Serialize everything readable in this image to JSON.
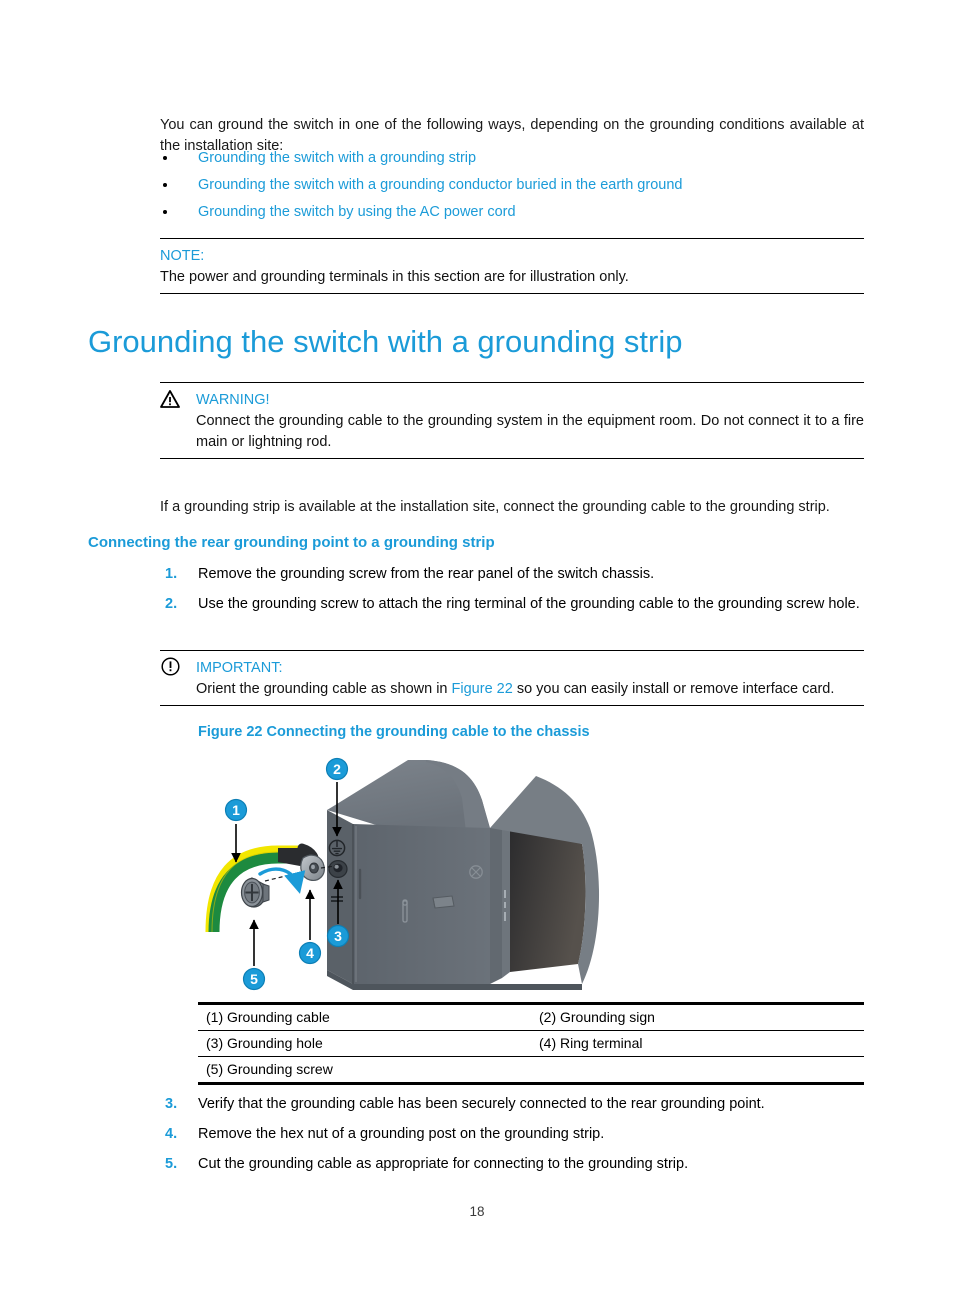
{
  "intro": {
    "paragraph": "You can ground the switch in one of the following ways, depending on the grounding conditions available at the installation site:"
  },
  "bullets": [
    {
      "label": "Grounding the switch with a grounding strip"
    },
    {
      "label": "Grounding the switch with a grounding conductor buried in the earth ground"
    },
    {
      "label": "Grounding the switch by using the AC power cord"
    }
  ],
  "note": {
    "title": "NOTE:",
    "body": "The power and grounding terminals in this section are for illustration only."
  },
  "heading": {
    "h1": "Grounding the switch with a grounding strip",
    "h3": "Connecting the rear grounding point to a grounding strip"
  },
  "warning": {
    "icon": "warning-triangle-icon",
    "title": "WARNING!",
    "body": "Connect the grounding cable to the grounding system in the equipment room. Do not connect it to a fire main or lightning rod."
  },
  "paragraph_after_warning": "If a grounding strip is available at the installation site, connect the grounding cable to the grounding strip.",
  "steps_first": [
    {
      "num": "1.",
      "text": "Remove the grounding screw from the rear panel of the switch chassis."
    },
    {
      "num": "2.",
      "text": "Use the grounding screw to attach the ring terminal of the grounding cable to the grounding screw hole."
    }
  ],
  "important": {
    "icon": "important-circle-icon",
    "title": "IMPORTANT:",
    "body_before_link": "Orient the grounding cable as shown in ",
    "link": "Figure 22",
    "body_after_link": " so you can easily install or remove interface card."
  },
  "figure": {
    "caption": "Figure 22 Connecting the grounding cable to the chassis",
    "callouts": [
      {
        "id": "1",
        "label": "Grounding cable"
      },
      {
        "id": "2",
        "label": "Grounding sign"
      },
      {
        "id": "3",
        "label": "Grounding hole"
      },
      {
        "id": "4",
        "label": "Ring terminal"
      },
      {
        "id": "5",
        "label": "Grounding screw"
      }
    ],
    "callout_numbers": {
      "c1": "1",
      "c2": "2",
      "c3": "3",
      "c4": "4",
      "c5": "5"
    }
  },
  "legend_rows": [
    {
      "left": "(1) Grounding cable",
      "right": "(2) Grounding sign"
    },
    {
      "left": "(3) Grounding hole",
      "right": "(4) Ring terminal"
    },
    {
      "left": "(5) Grounding screw",
      "right": ""
    }
  ],
  "steps_second": [
    {
      "num": "3.",
      "text": "Verify that the grounding cable has been securely connected to the rear grounding point."
    },
    {
      "num": "4.",
      "text": "Remove the hex nut of a grounding post on the grounding strip."
    },
    {
      "num": "5.",
      "text": "Cut the grounding cable as appropriate for connecting to the grounding strip."
    }
  ],
  "footer": {
    "page_number": "18"
  },
  "colors": {
    "accent_blue": "#1b9bd8",
    "cable_green": "#1d8a3f",
    "cable_yellow": "#f2e600",
    "chassis_gray": "#6e757c",
    "rule_black": "#000000"
  }
}
